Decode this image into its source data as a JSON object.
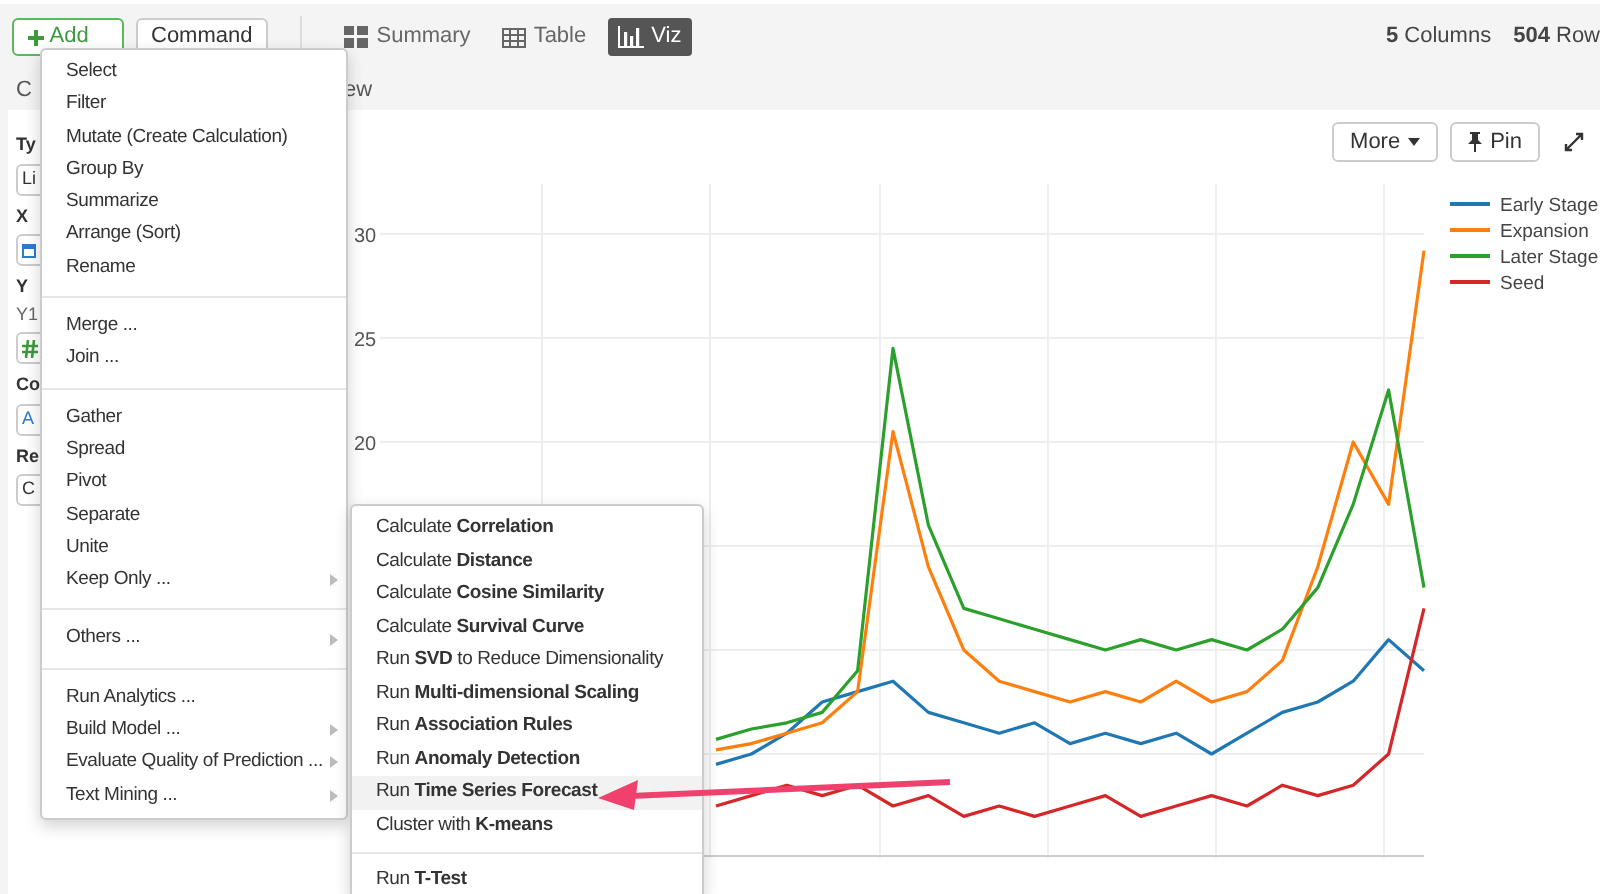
{
  "toolbar": {
    "add_button": "Add",
    "command_button": "Command",
    "view_tabs": [
      {
        "label": "Summary",
        "kind": "summary",
        "selected": false
      },
      {
        "label": "Table",
        "kind": "table",
        "selected": false
      },
      {
        "label": "Viz",
        "kind": "viz",
        "selected": true
      }
    ],
    "stats": [
      {
        "count": "5",
        "label": "Columns"
      },
      {
        "count": "504",
        "label": "Row"
      }
    ]
  },
  "subtabs": [
    "C",
    "ew"
  ],
  "sidebar": {
    "fields": [
      {
        "label": "Ty",
        "kind": "value",
        "value": "Li"
      },
      {
        "label": "X",
        "kind": "date"
      },
      {
        "label": "Y",
        "note": "Y1",
        "kind": "number"
      },
      {
        "label": "Co",
        "kind": "letter",
        "value": "A"
      },
      {
        "label": "Re",
        "kind": "value",
        "value": "C"
      }
    ]
  },
  "chart_panel": {
    "buttons": [
      {
        "label": "More",
        "kind": "dropdown"
      },
      {
        "label": "Pin",
        "kind": "pin"
      }
    ],
    "chart_data": {
      "type": "line",
      "grid": true,
      "legend": true,
      "ylim": [
        0,
        32.4
      ],
      "yticks": [
        20,
        25,
        30
      ],
      "series": [
        {
          "name": "Early Stage",
          "color": "#1f77b4",
          "values": [
            4.5,
            5.0,
            6.0,
            7.5,
            8.0,
            8.5,
            7.0,
            6.5,
            6.0,
            6.5,
            5.5,
            6.0,
            5.5,
            6.0,
            5.0,
            6.0,
            7.0,
            7.5,
            8.5,
            10.5,
            9.0
          ]
        },
        {
          "name": "Expansion",
          "color": "#ff7f0e",
          "values": [
            5.2,
            5.5,
            6.0,
            6.5,
            8.0,
            20.5,
            14.0,
            10.0,
            8.5,
            8.0,
            7.5,
            8.0,
            7.5,
            8.5,
            7.5,
            8.0,
            9.5,
            14.0,
            20.0,
            17.0,
            29.2
          ]
        },
        {
          "name": "Later Stage",
          "color": "#2ca02c",
          "values": [
            5.7,
            6.2,
            6.5,
            7.0,
            9.0,
            24.5,
            16.0,
            12.0,
            11.5,
            11.0,
            10.5,
            10.0,
            10.5,
            10.0,
            10.5,
            10.0,
            11.0,
            13.0,
            17.0,
            22.5,
            13.0
          ]
        },
        {
          "name": "Seed",
          "color": "#d62728",
          "values": [
            2.5,
            3.0,
            3.5,
            3.0,
            3.5,
            2.5,
            3.0,
            2.0,
            2.5,
            2.0,
            2.5,
            3.0,
            2.0,
            2.5,
            3.0,
            2.5,
            3.5,
            3.0,
            3.5,
            5.0,
            12.0
          ]
        }
      ]
    }
  },
  "add_menu": {
    "groups": [
      [
        {
          "label": "Select",
          "submenu": false
        },
        {
          "label": "Filter",
          "submenu": false
        },
        {
          "label": "Mutate (Create Calculation)",
          "submenu": false
        },
        {
          "label": "Group By",
          "submenu": false
        },
        {
          "label": "Summarize",
          "submenu": false
        },
        {
          "label": "Arrange (Sort)",
          "submenu": false
        },
        {
          "label": "Rename",
          "submenu": false
        }
      ],
      [
        {
          "label": "Merge ...",
          "submenu": false
        },
        {
          "label": "Join ...",
          "submenu": false
        }
      ],
      [
        {
          "label": "Gather",
          "submenu": false
        },
        {
          "label": "Spread",
          "submenu": false
        },
        {
          "label": "Pivot",
          "submenu": false
        },
        {
          "label": "Separate",
          "submenu": false
        },
        {
          "label": "Unite",
          "submenu": false
        },
        {
          "label": "Keep Only ...",
          "submenu": true
        }
      ],
      [
        {
          "label": "Others ...",
          "submenu": true
        }
      ],
      [
        {
          "label": "Run Analytics ...",
          "submenu": false
        },
        {
          "label": "Build Model ...",
          "submenu": true
        },
        {
          "label": "Evaluate Quality of Prediction ...",
          "submenu": true
        },
        {
          "label": "Text Mining ...",
          "submenu": true
        }
      ]
    ]
  },
  "analytics_menu": {
    "groups": [
      [
        {
          "label": "Calculate **Correlation**",
          "selected": false
        },
        {
          "label": "Calculate **Distance**",
          "selected": false
        },
        {
          "label": "Calculate **Cosine Similarity**",
          "selected": false
        },
        {
          "label": "Calculate **Survival Curve**",
          "selected": false
        },
        {
          "label": "Run **SVD** to Reduce Dimensionality",
          "selected": false
        },
        {
          "label": "Run **Multi-dimensional Scaling**",
          "selected": false
        },
        {
          "label": "Run **Association Rules**",
          "selected": false
        },
        {
          "label": "Run **Anomaly Detection**",
          "selected": false
        },
        {
          "label": "Run **Time Series Forecast**",
          "selected": true
        },
        {
          "label": "Cluster with **K-means**",
          "selected": false
        }
      ],
      [
        {
          "label": "Run **T-Test**",
          "selected": false
        }
      ]
    ]
  }
}
